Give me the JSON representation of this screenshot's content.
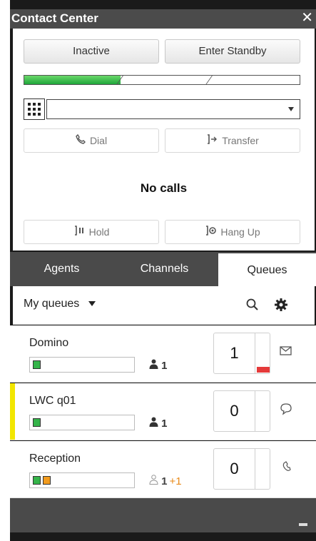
{
  "window": {
    "title": "Contact Center",
    "close_glyph": "✕"
  },
  "controls": {
    "inactive_label": "Inactive",
    "standby_label": "Enter Standby",
    "dial_input_value": "",
    "dial_label": "Dial",
    "transfer_label": "Transfer",
    "hold_label": "Hold",
    "hangup_label": "Hang Up",
    "status_progress_fraction": 0.35
  },
  "call_status": "No calls",
  "tabs": [
    {
      "label": "Agents",
      "active": false
    },
    {
      "label": "Channels",
      "active": false
    },
    {
      "label": "Queues",
      "active": true
    }
  ],
  "filter": {
    "label": "My queues"
  },
  "queues": [
    {
      "name": "Domino",
      "agents": "1",
      "extra": "",
      "count": "1",
      "channel_icon": "envelope-icon",
      "accent": "",
      "squares": [
        "#35b44a"
      ],
      "meter": true
    },
    {
      "name": "LWC q01",
      "agents": "1",
      "extra": "",
      "count": "0",
      "channel_icon": "chat-bubble-icon",
      "accent": "#f2e600",
      "squares": [
        "#35b44a"
      ],
      "meter": false
    },
    {
      "name": "Reception",
      "agents": "1",
      "extra": "+1",
      "count": "0",
      "channel_icon": "phone-icon",
      "accent": "",
      "squares": [
        "#35b44a",
        "#f29b1d"
      ],
      "meter": false
    }
  ],
  "colors": {
    "progress_green": "#2fb040",
    "alert_red": "#e53a3a",
    "accent_yellow": "#f2e600",
    "tab_bg": "#4a4a4a"
  }
}
